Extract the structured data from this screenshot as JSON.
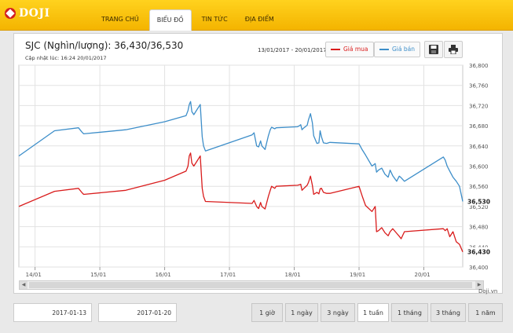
{
  "logo_text": "DOJI",
  "nav": [
    "TRANG CHỦ",
    "BIỂU ĐỒ",
    "TIN TỨC",
    "ĐỊA ĐIỂM"
  ],
  "title": "SJC (Nghìn/lượng): 36,430/36,530",
  "updated": "Cập nhật lúc: 16:24 20/01/2017",
  "range_text": "13/01/2017 - 20/01/2017",
  "legend": {
    "buy": "Giá mua",
    "sell": "Giá bán"
  },
  "icons": {
    "save": "floppy-disk-icon",
    "print": "printer-icon"
  },
  "colors": {
    "buy": "#d91c1c",
    "sell": "#3d8ec9",
    "topbar": "#f4b400"
  },
  "credit": "Doji.vn",
  "date_from": "2017-01-13",
  "date_to": "2017-01-20",
  "ranges": [
    "1 giờ",
    "1 ngày",
    "3 ngày",
    "1 tuần",
    "1 tháng",
    "3 tháng",
    "1 năm"
  ],
  "active_range": "1 tuần",
  "chart_data": {
    "type": "line",
    "x_ticks": [
      "14/01",
      "15/01",
      "16/01",
      "17/01",
      "18/01",
      "19/01",
      "20/01"
    ],
    "y_ticks": [
      "36,800",
      "36,760",
      "36,720",
      "36,680",
      "36,640",
      "36,600",
      "36,560",
      "36,520",
      "36,480",
      "36,440",
      "36,400"
    ],
    "ylim": [
      36400,
      36800
    ],
    "xlim": [
      13.75,
      20.6
    ],
    "last_labels": {
      "buy": "36,430",
      "sell": "36,530"
    },
    "series": [
      {
        "name": "Giá bán",
        "color": "#3d8ec9",
        "x": [
          13.75,
          14.3,
          14.67,
          14.72,
          14.75,
          15.4,
          16.0,
          16.33,
          16.36,
          16.38,
          16.4,
          16.42,
          16.45,
          16.5,
          16.55,
          16.58,
          16.6,
          16.63,
          17.35,
          17.38,
          17.42,
          17.45,
          17.48,
          17.5,
          17.55,
          17.6,
          17.63,
          17.65,
          17.7,
          17.72,
          18.05,
          18.08,
          18.1,
          18.12,
          18.15,
          18.2,
          18.22,
          18.25,
          18.28,
          18.3,
          18.35,
          18.38,
          18.4,
          18.42,
          18.45,
          18.5,
          18.55,
          19.0,
          19.05,
          19.1,
          19.2,
          19.25,
          19.27,
          19.3,
          19.35,
          19.4,
          19.45,
          19.48,
          19.52,
          19.58,
          19.62,
          19.65,
          19.7,
          20.3,
          20.33,
          20.36,
          20.4,
          20.45,
          20.5,
          20.55,
          20.6
        ],
        "y": [
          36620,
          36670,
          36676,
          36668,
          36664,
          36672,
          36688,
          36700,
          36710,
          36722,
          36728,
          36708,
          36702,
          36712,
          36722,
          36658,
          36640,
          36630,
          36662,
          36666,
          36640,
          36638,
          36650,
          36640,
          36633,
          36660,
          36672,
          36677,
          36674,
          36676,
          36678,
          36680,
          36682,
          36672,
          36676,
          36681,
          36692,
          36704,
          36686,
          36660,
          36645,
          36646,
          36670,
          36658,
          36646,
          36645,
          36647,
          36644,
          36632,
          36622,
          36600,
          36605,
          36588,
          36592,
          36596,
          36584,
          36578,
          36592,
          36581,
          36570,
          36580,
          36577,
          36570,
          36618,
          36612,
          36600,
          36590,
          36578,
          36570,
          36560,
          36530
        ]
      },
      {
        "name": "Giá mua",
        "color": "#d91c1c",
        "x": [
          13.75,
          14.3,
          14.67,
          14.72,
          14.75,
          15.4,
          16.0,
          16.33,
          16.36,
          16.38,
          16.4,
          16.42,
          16.45,
          16.5,
          16.55,
          16.58,
          16.6,
          16.63,
          17.35,
          17.38,
          17.42,
          17.45,
          17.48,
          17.5,
          17.55,
          17.6,
          17.63,
          17.65,
          17.7,
          17.72,
          18.05,
          18.08,
          18.1,
          18.12,
          18.15,
          18.2,
          18.22,
          18.25,
          18.28,
          18.3,
          18.35,
          18.38,
          18.4,
          18.42,
          18.45,
          18.5,
          18.55,
          19.0,
          19.05,
          19.1,
          19.2,
          19.25,
          19.27,
          19.3,
          19.35,
          19.4,
          19.45,
          19.48,
          19.52,
          19.58,
          19.62,
          19.65,
          19.7,
          20.3,
          20.33,
          20.36,
          20.4,
          20.45,
          20.5,
          20.55,
          20.6
        ],
        "y": [
          36520,
          36550,
          36556,
          36548,
          36544,
          36552,
          36572,
          36590,
          36600,
          36620,
          36626,
          36606,
          36600,
          36610,
          36620,
          36556,
          36540,
          36530,
          36526,
          36532,
          36520,
          36516,
          36528,
          36520,
          36515,
          36540,
          36552,
          36560,
          36556,
          36560,
          36562,
          36563,
          36564,
          36552,
          36556,
          36562,
          36568,
          36580,
          36562,
          36544,
          36548,
          36545,
          36555,
          36556,
          36548,
          36546,
          36546,
          36560,
          36540,
          36522,
          36510,
          36520,
          36470,
          36472,
          36478,
          36468,
          36462,
          36470,
          36476,
          36467,
          36461,
          36456,
          36470,
          36476,
          36472,
          36476,
          36460,
          36470,
          36450,
          36445,
          36430
        ]
      }
    ]
  }
}
